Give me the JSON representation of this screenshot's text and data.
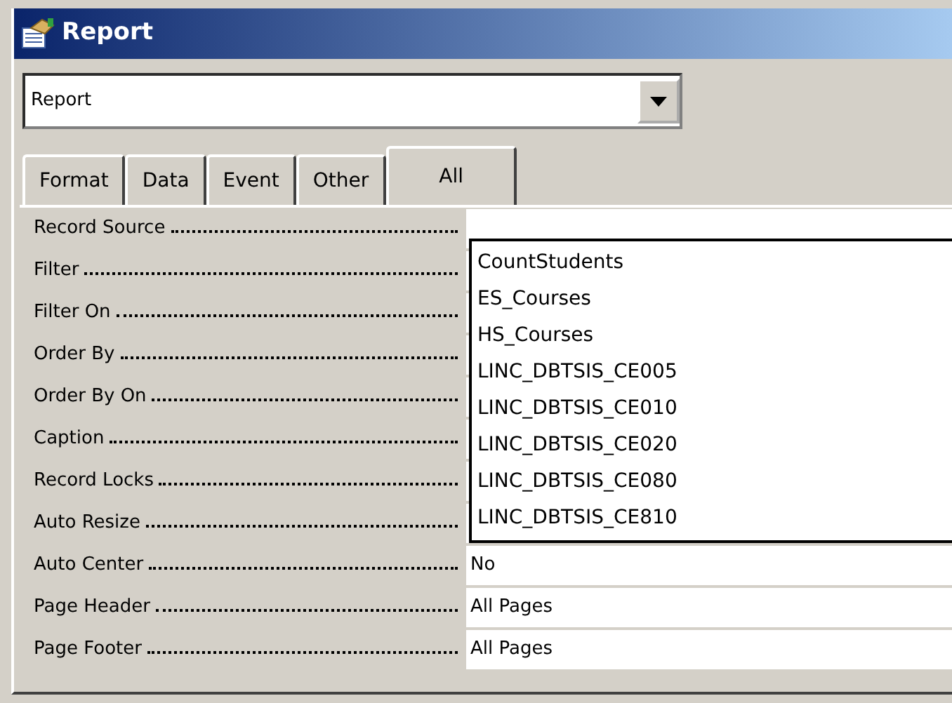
{
  "window": {
    "title": "Report"
  },
  "object_selector": {
    "value": "Report"
  },
  "tabs": [
    {
      "label": "Format",
      "selected": false
    },
    {
      "label": "Data",
      "selected": false
    },
    {
      "label": "Event",
      "selected": false
    },
    {
      "label": "Other",
      "selected": false
    },
    {
      "label": "All",
      "selected": true
    }
  ],
  "properties": [
    {
      "label": "Record Source"
    },
    {
      "label": "Filter"
    },
    {
      "label": "Filter On"
    },
    {
      "label": "Order By"
    },
    {
      "label": "Order By On"
    },
    {
      "label": "Caption"
    },
    {
      "label": "Record Locks"
    },
    {
      "label": "Auto Resize"
    },
    {
      "label": "Auto Center",
      "value": "No"
    },
    {
      "label": "Page Header",
      "value": "All Pages"
    },
    {
      "label": "Page Footer",
      "value": "All Pages"
    }
  ],
  "dropdown_list": {
    "items": [
      "CountStudents",
      "ES_Courses",
      "HS_Courses",
      "LINC_DBTSIS_CE005",
      "LINC_DBTSIS_CE010",
      "LINC_DBTSIS_CE020",
      "LINC_DBTSIS_CE080",
      "LINC_DBTSIS_CE810"
    ]
  }
}
